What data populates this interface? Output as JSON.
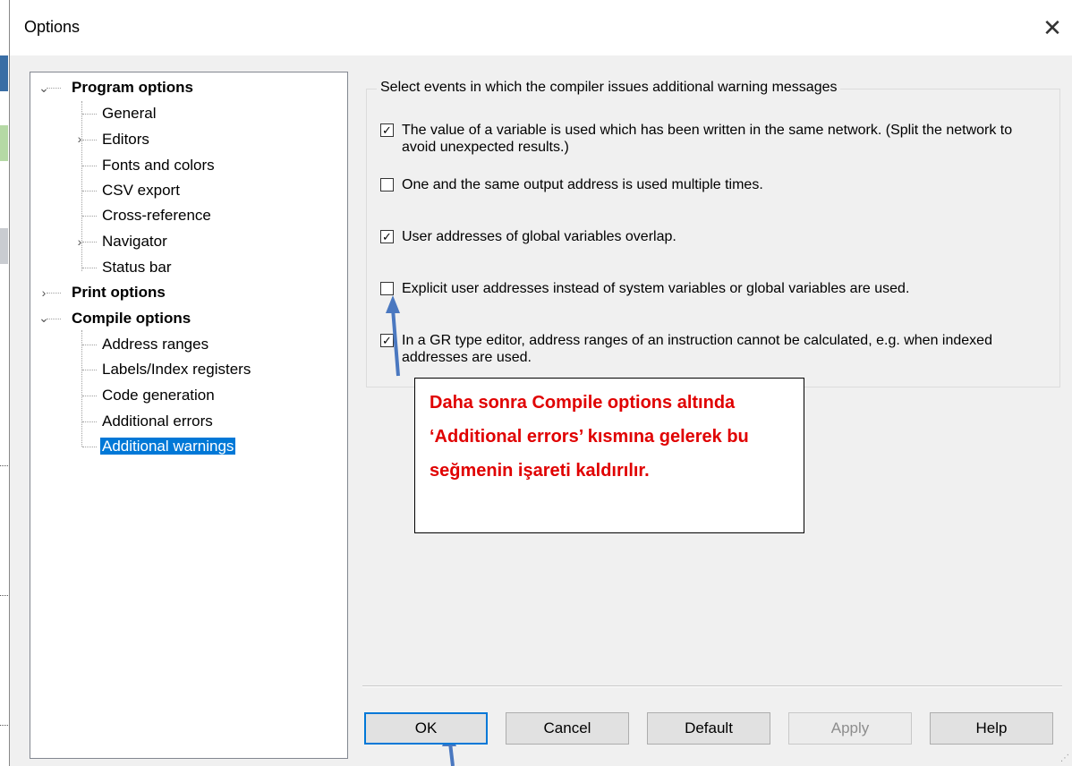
{
  "window": {
    "title": "Options",
    "close_icon": "close-icon"
  },
  "tree": {
    "program_options": "Program options",
    "general": "General",
    "editors": "Editors",
    "fonts_colors": "Fonts and colors",
    "csv_export": "CSV export",
    "cross_reference": "Cross-reference",
    "navigator": "Navigator",
    "status_bar": "Status bar",
    "print_options": "Print options",
    "compile_options": "Compile options",
    "address_ranges": "Address ranges",
    "labels_index": "Labels/Index registers",
    "code_generation": "Code generation",
    "additional_errors": "Additional errors",
    "additional_warnings": "Additional warnings",
    "selected": "Additional warnings"
  },
  "warnings": {
    "group_title": "Select events in which the compiler issues additional warning messages",
    "options": [
      {
        "label": "The value of a variable is used which has been written in the same network. (Split the network to avoid unexpected results.)",
        "checked": true
      },
      {
        "label": "One and the same output address is used multiple times.",
        "checked": false
      },
      {
        "label": "User addresses of global variables overlap.",
        "checked": true
      },
      {
        "label": "Explicit user addresses instead of system variables or global variables are used.",
        "checked": false
      },
      {
        "label": "In a GR type editor, address ranges of an instruction cannot be calculated, e.g. when indexed addresses are used.",
        "checked": true
      }
    ]
  },
  "annotation": {
    "text": "Daha sonra Compile options altında ‘Additional errors’ kısmına gelerek bu seğmenin işareti kaldırılır.",
    "color": "#e00000",
    "arrow_color": "#4a78c0"
  },
  "buttons": {
    "ok": "OK",
    "cancel": "Cancel",
    "default": "Default",
    "apply": "Apply",
    "help": "Help"
  },
  "colors": {
    "selection": "#0078d7",
    "dialog_bg": "#f0f0f0"
  }
}
